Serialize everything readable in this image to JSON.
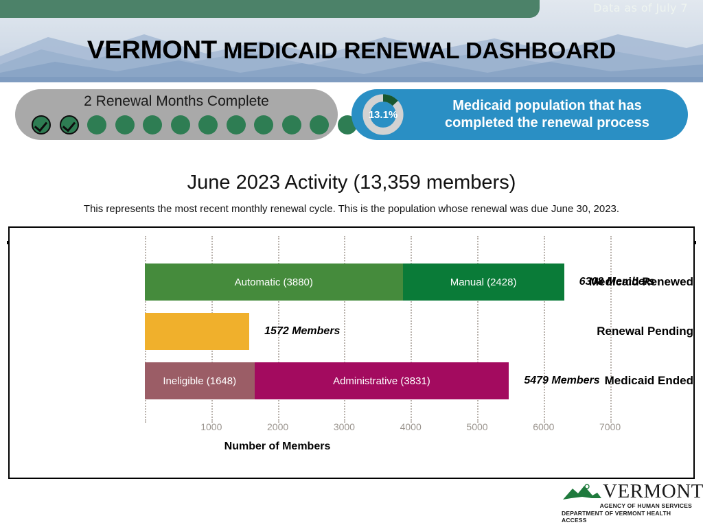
{
  "header": {
    "banner_text": "Data as of July 7",
    "title_strong": "VERMONT",
    "title_rest": "MEDICAID RENEWAL DASHBOARD"
  },
  "kpi": {
    "months": {
      "label": "2 Renewal Months Complete",
      "total_dots": 12,
      "completed_dots": 2
    },
    "donut": {
      "percent_label": "13.1%",
      "percent_value": 13.1,
      "caption_line1": "Medicaid population that has",
      "caption_line2": "completed the renewal process",
      "arc_color": "#19572f",
      "track_color": "#d2d2d2",
      "pill_color": "#2a8fc4"
    }
  },
  "section": {
    "title": "June 2023 Activity (13,359 members)",
    "subtitle": "This represents the most recent monthly renewal cycle. This is the population whose renewal was due June 30, 2023."
  },
  "chart_data": {
    "type": "bar",
    "orientation": "horizontal",
    "stacked": true,
    "title": "June 2023 Activity (13,359 members)",
    "xlabel": "Number of Members",
    "ylabel": "",
    "xlim": [
      0,
      7400
    ],
    "xticks": [
      1000,
      2000,
      3000,
      4000,
      5000,
      6000,
      7000
    ],
    "xticklabels": [
      "1000",
      "2000",
      "3000",
      "4000",
      "5000",
      "6000",
      "7000"
    ],
    "grid": true,
    "grid_style": "dotted-vertical",
    "categories": [
      "Medicaid Renewed",
      "Renewal Pending",
      "Medicaid Ended"
    ],
    "totals": [
      6308,
      1572,
      5479
    ],
    "total_labels": [
      "6308 Members",
      "1572 Members",
      "5479 Members"
    ],
    "rows": [
      {
        "category": "Medicaid Renewed",
        "total": 6308,
        "total_label": "6308 Members",
        "segments": [
          {
            "name": "Automatic",
            "value": 3880,
            "label": "Automatic (3880)",
            "color": "#458b3c"
          },
          {
            "name": "Manual",
            "value": 2428,
            "label": "Manual (2428)",
            "color": "#0a7b38"
          }
        ]
      },
      {
        "category": "Renewal Pending",
        "total": 1572,
        "total_label": "1572 Members",
        "segments": [
          {
            "name": "Pending",
            "value": 1572,
            "label": "",
            "color": "#f0b02c"
          }
        ]
      },
      {
        "category": "Medicaid Ended",
        "total": 5479,
        "total_label": "5479 Members",
        "segments": [
          {
            "name": "Ineligible",
            "value": 1648,
            "label": "Ineligible (1648)",
            "color": "#9b5d66"
          },
          {
            "name": "Administrative",
            "value": 3831,
            "label": "Administrative (3831)",
            "color": "#a30b5f"
          }
        ]
      }
    ],
    "series": [
      {
        "name": "Automatic",
        "values": [
          3880,
          0,
          0
        ],
        "color": "#458b3c"
      },
      {
        "name": "Manual",
        "values": [
          2428,
          0,
          0
        ],
        "color": "#0a7b38"
      },
      {
        "name": "Pending",
        "values": [
          0,
          1572,
          0
        ],
        "color": "#f0b02c"
      },
      {
        "name": "Ineligible",
        "values": [
          0,
          0,
          1648
        ],
        "color": "#9b5d66"
      },
      {
        "name": "Administrative",
        "values": [
          0,
          0,
          3831
        ],
        "color": "#a30b5f"
      }
    ]
  },
  "logo": {
    "wordmark": "VERMONT",
    "line1": "AGENCY OF HUMAN SERVICES",
    "line2": "DEPARTMENT OF VERMONT HEALTH ACCESS"
  }
}
